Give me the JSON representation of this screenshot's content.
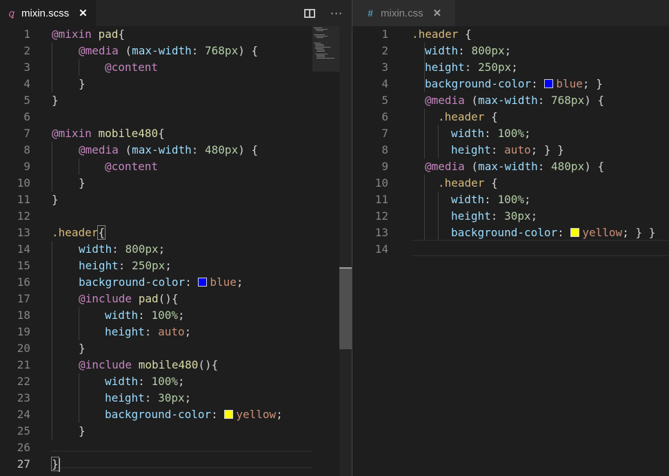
{
  "left_pane": {
    "tab": {
      "icon": "sass-icon",
      "label": "mixin.scss",
      "close": "✕"
    },
    "actions": {
      "split_icon": "split-editor-icon",
      "more_label": "···"
    },
    "lines": [
      {
        "n": "1"
      },
      {
        "n": "2"
      },
      {
        "n": "3"
      },
      {
        "n": "4"
      },
      {
        "n": "5"
      },
      {
        "n": "6"
      },
      {
        "n": "7"
      },
      {
        "n": "8"
      },
      {
        "n": "9"
      },
      {
        "n": "10"
      },
      {
        "n": "11"
      },
      {
        "n": "12"
      },
      {
        "n": "13"
      },
      {
        "n": "14"
      },
      {
        "n": "15"
      },
      {
        "n": "16"
      },
      {
        "n": "17"
      },
      {
        "n": "18"
      },
      {
        "n": "19"
      },
      {
        "n": "20"
      },
      {
        "n": "21"
      },
      {
        "n": "22"
      },
      {
        "n": "23"
      },
      {
        "n": "24"
      },
      {
        "n": "25"
      },
      {
        "n": "26"
      },
      {
        "n": "27"
      }
    ],
    "tokens": {
      "l1": [
        "@mixin",
        " ",
        "pad",
        "{"
      ],
      "l2": [
        "@media",
        " (",
        "max-width",
        ": ",
        "768px",
        ") {"
      ],
      "l3": [
        "@content"
      ],
      "l4": [
        "}"
      ],
      "l5": [
        "}"
      ],
      "l7": [
        "@mixin",
        " ",
        "mobile480",
        "{"
      ],
      "l8": [
        "@media",
        " (",
        "max-width",
        ": ",
        "480px",
        ") {"
      ],
      "l9": [
        "@content"
      ],
      "l10": [
        "}"
      ],
      "l11": [
        "}"
      ],
      "l13": [
        ".header",
        "{"
      ],
      "l14": [
        "width",
        ": ",
        "800px",
        ";"
      ],
      "l15": [
        "height",
        ": ",
        "250px",
        ";"
      ],
      "l16": [
        "background-color",
        ": ",
        "blue",
        ";"
      ],
      "l17": [
        "@include",
        " ",
        "pad",
        "(){"
      ],
      "l18": [
        "width",
        ": ",
        "100%",
        ";"
      ],
      "l19": [
        "height",
        ": ",
        "auto",
        ";"
      ],
      "l20": [
        "}"
      ],
      "l21": [
        "@include",
        " ",
        "mobile480",
        "(){"
      ],
      "l22": [
        "width",
        ": ",
        "100%",
        ";"
      ],
      "l23": [
        "height",
        ": ",
        "30px",
        ";"
      ],
      "l24": [
        "background-color",
        ": ",
        "yellow",
        ";"
      ],
      "l25": [
        "}"
      ],
      "l27": [
        "}"
      ]
    },
    "swatches": {
      "blue": "#0000ff",
      "yellow": "#ffff00"
    }
  },
  "right_pane": {
    "tab": {
      "icon": "css-icon",
      "label": "mixin.css",
      "close": "✕"
    },
    "lines": [
      {
        "n": "1"
      },
      {
        "n": "2"
      },
      {
        "n": "3"
      },
      {
        "n": "4"
      },
      {
        "n": "5"
      },
      {
        "n": "6"
      },
      {
        "n": "7"
      },
      {
        "n": "8"
      },
      {
        "n": "9"
      },
      {
        "n": "10"
      },
      {
        "n": "11"
      },
      {
        "n": "12"
      },
      {
        "n": "13"
      },
      {
        "n": "14"
      }
    ],
    "tokens": {
      "l1": [
        ".header",
        " {"
      ],
      "l2": [
        "width",
        ": ",
        "800px",
        ";"
      ],
      "l3": [
        "height",
        ": ",
        "250px",
        ";"
      ],
      "l4": [
        "background-color",
        ": ",
        "blue",
        "; }"
      ],
      "l5": [
        "@media",
        " (",
        "max-width",
        ": ",
        "768px",
        ") {"
      ],
      "l6": [
        ".header",
        " {"
      ],
      "l7": [
        "width",
        ": ",
        "100%",
        ";"
      ],
      "l8": [
        "height",
        ": ",
        "auto",
        "; } }"
      ],
      "l9": [
        "@media",
        " (",
        "max-width",
        ": ",
        "480px",
        ") {"
      ],
      "l10": [
        ".header",
        " {"
      ],
      "l11": [
        "width",
        ": ",
        "100%",
        ";"
      ],
      "l12": [
        "height",
        ": ",
        "30px",
        ";"
      ],
      "l13": [
        "background-color",
        ": ",
        "yellow",
        "; } }"
      ]
    }
  },
  "colors": {
    "background": "#1e1e1e",
    "keyword": "#c586c0",
    "selector": "#d7ba7d",
    "function": "#dcdcaa",
    "property": "#9cdcfe",
    "number": "#b5cea8",
    "value": "#ce9178"
  }
}
